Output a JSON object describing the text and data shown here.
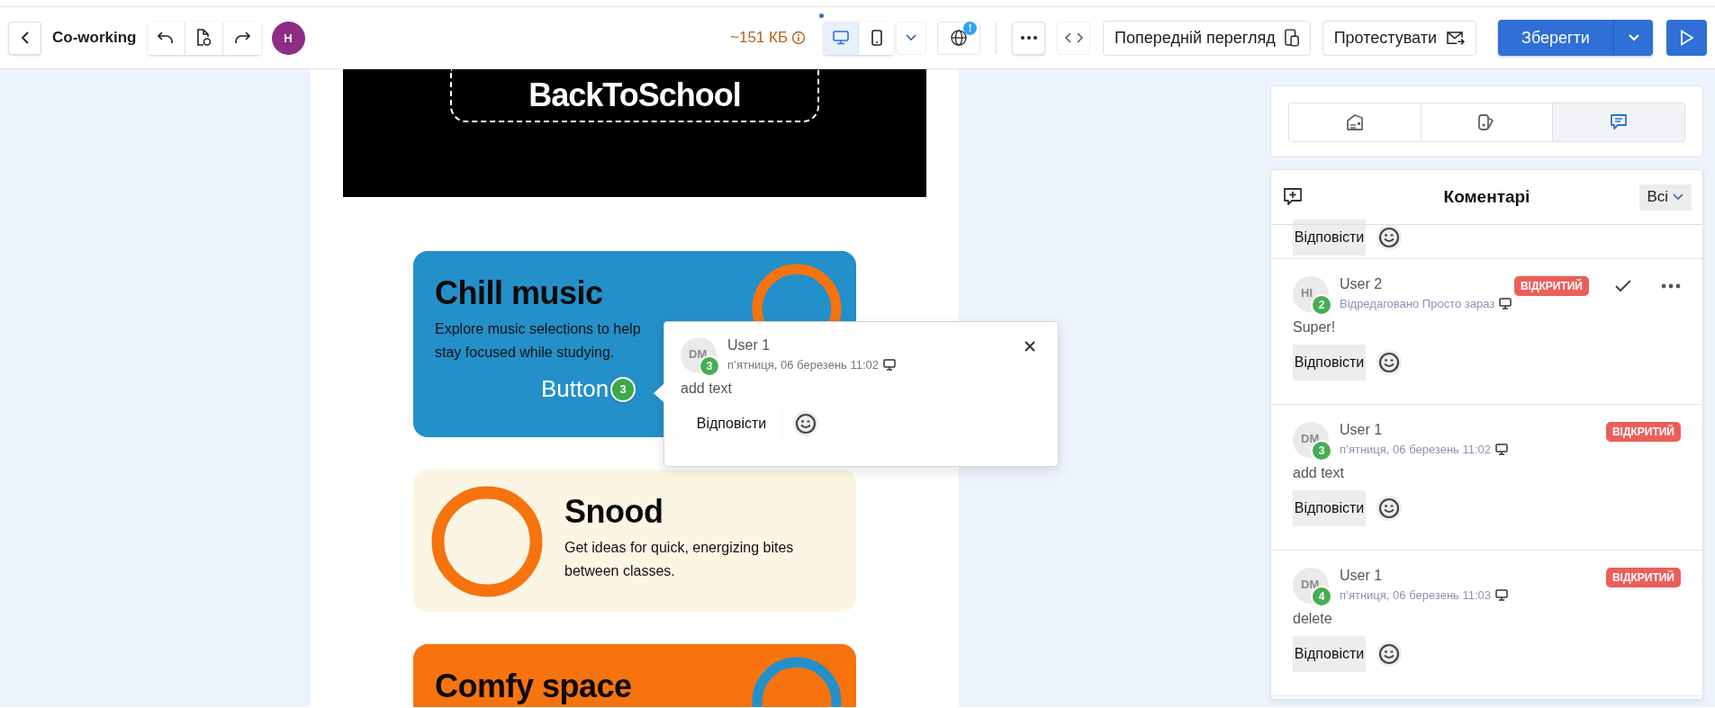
{
  "toolbar": {
    "title": "Co-working",
    "avatar": "H",
    "size": "~151 КБ",
    "globe_badge": "!",
    "devices": [
      {
        "kind": "desktop",
        "selected": true
      },
      {
        "kind": "mobile",
        "selected": false
      }
    ],
    "preview": "Попередній перегляд",
    "test": "Протестувати",
    "save": "Зберегти"
  },
  "canvas": {
    "banner": "BackToSchool",
    "cards": [
      {
        "kind": "ring-right",
        "color": "#2490c9",
        "ring": {
          "color": "#f7730e"
        },
        "title": "Chill music",
        "text": "Explore music selections to help\nstay focused while studying.",
        "button": "Button",
        "badge": "3"
      },
      {
        "kind": "ring-left",
        "color": "#fdf5e4",
        "ring": {
          "color": "#f7730e"
        },
        "title": "Snood",
        "text": "Get ideas for quick, energizing bites\nbetween classes."
      },
      {
        "kind": "ring-right",
        "color": "#f7730e",
        "ring": {
          "color": "#2490c9"
        },
        "title": "Comfy space"
      }
    ]
  },
  "popup": {
    "initials": "DM",
    "number": "3",
    "author": "User 1",
    "meta": "п’ятниця, 06 березень 11:02",
    "text": "add text",
    "reply": "Відповісти"
  },
  "panel_tabs": [
    {
      "kind": "blocks",
      "selected": false
    },
    {
      "kind": "styles",
      "selected": false
    },
    {
      "kind": "comments",
      "selected": true
    }
  ],
  "comments_panel": {
    "title": "Коментарі",
    "filter": "Всі",
    "comments": [
      {
        "kind": "tail",
        "reply": "Відповісти"
      },
      {
        "kind": "full",
        "initials": "HI",
        "number": "2",
        "author": "User 2",
        "meta": "Відредаговано Просто зараз",
        "status": "ВІДКРИТИЙ",
        "actions_visible": true,
        "text": "Super!",
        "reply": "Відповісти"
      },
      {
        "kind": "full",
        "initials": "DM",
        "number": "3",
        "author": "User 1",
        "meta": "п’ятниця, 06 березень 11:02",
        "status": "ВІДКРИТИЙ",
        "actions_visible": false,
        "text": "add text",
        "reply": "Відповісти"
      },
      {
        "kind": "full",
        "initials": "DM",
        "number": "4",
        "author": "User 1",
        "meta": "п’ятниця, 06 березень 11:03",
        "status": "ВІДКРИТИЙ",
        "actions_visible": false,
        "text": "delete",
        "reply": "Відповісти"
      }
    ]
  }
}
